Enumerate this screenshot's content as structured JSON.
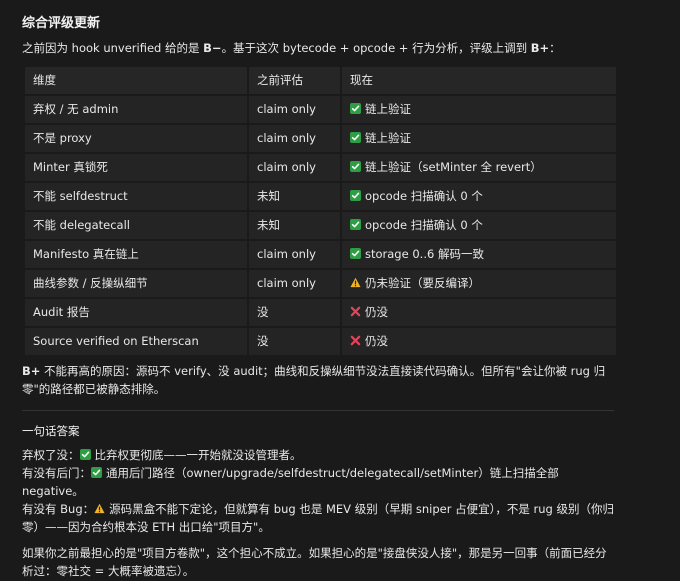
{
  "section1": {
    "title": "综合评级更新",
    "lead_pre": "之前因为 hook unverified 给的是 ",
    "lead_b1": "B−",
    "lead_mid": "。基于这次 bytecode + opcode + 行为分析，评级上调到 ",
    "lead_b2": "B+",
    "lead_post": "："
  },
  "table": {
    "headers": [
      "维度",
      "之前评估",
      "现在"
    ],
    "rows": [
      {
        "dim": "弃权 / 无 admin",
        "before": "claim only",
        "icon": "check-icon",
        "now": "链上验证"
      },
      {
        "dim": "不是 proxy",
        "before": "claim only",
        "icon": "check-icon",
        "now": "链上验证"
      },
      {
        "dim": "Minter 真锁死",
        "before": "claim only",
        "icon": "check-icon",
        "now": "链上验证（setMinter 全 revert）"
      },
      {
        "dim": "不能 selfdestruct",
        "before": "未知",
        "icon": "check-icon",
        "now": "opcode 扫描确认 0 个"
      },
      {
        "dim": "不能 delegatecall",
        "before": "未知",
        "icon": "check-icon",
        "now": "opcode 扫描确认 0 个"
      },
      {
        "dim": "Manifesto 真在链上",
        "before": "claim only",
        "icon": "check-icon",
        "now": "storage 0..6 解码一致"
      },
      {
        "dim": "曲线参数 / 反操纵细节",
        "before": "claim only",
        "icon": "warning-icon",
        "now": "仍未验证（要反编译）"
      },
      {
        "dim": "Audit 报告",
        "before": "没",
        "icon": "cross-icon",
        "now": "仍没"
      },
      {
        "dim": "Source verified on Etherscan",
        "before": "没",
        "icon": "cross-icon",
        "now": "仍没"
      }
    ]
  },
  "note": {
    "bold": "B+",
    "text": " 不能再高的原因：源码不 verify、没 audit；曲线和反操纵细节没法直接读代码确认。但所有\"会让你被 rug 归零\"的路径都已被静态排除。"
  },
  "section2": {
    "title": "一句话答案",
    "line1_label": "弃权了没：",
    "line1_text": "比弃权更彻底——一开始就没设管理者。",
    "line2_label": "有没有后门：",
    "line2_text": "通用后门路径（owner/upgrade/selfdestruct/delegatecall/setMinter）链上扫描全部 negative。",
    "line3_label": "有没有 Bug：",
    "line3_text": "源码黑盒不能下定论，但就算有 bug 也是 MEV 级别（早期 sniper 占便宜），不是 rug 级别（你归零）——因为合约根本没 ETH 出口给\"项目方\"。",
    "closing": "如果你之前最担心的是\"项目方卷款\"，这个担心不成立。如果担心的是\"接盘侠没人接\"，那是另一回事（前面已经分析过：零社交 = 大概率被遗忘）。"
  },
  "colors": {
    "check": "#2e9e45",
    "warning": "#f0b429",
    "cross": "#e0455a"
  }
}
